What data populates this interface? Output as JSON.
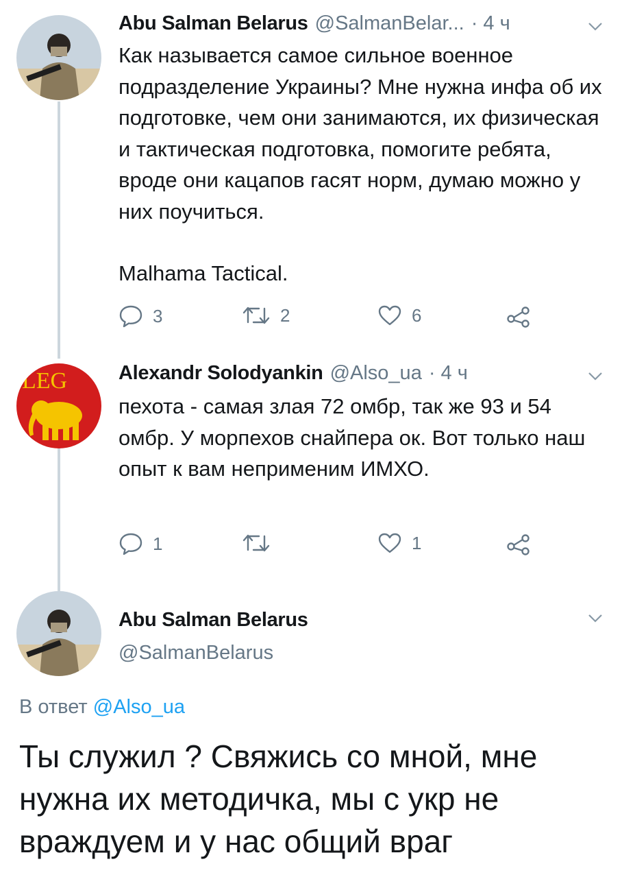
{
  "tweets": [
    {
      "name": "Abu Salman Belarus",
      "handle": "@SalmanBelar...",
      "time": "· 4 ч",
      "text": "Как называется самое сильное военное подразделение Украины? Мне нужна инфа об их подготовке, чем они занимаются, их физическая и тактическая подготовка, помогите ребята, вроде они кацапов гасят норм, думаю можно у них поучиться.",
      "text2": "Malhama Tactical.",
      "reply_count": "3",
      "retweet_count": "2",
      "like_count": "6"
    },
    {
      "name": "Alexandr Solodyankin",
      "handle": "@Also_ua",
      "time": "· 4 ч",
      "avatar_text": "LEG",
      "text": "пехота - самая злая 72 омбр, так же 93 и 54 омбр. У морпехов снайпера ок. Вот только наш опыт к вам неприменим ИМХО.",
      "reply_count": "1",
      "retweet_count": "",
      "like_count": "1"
    }
  ],
  "main_tweet": {
    "name": "Abu Salman Belarus",
    "handle": "@SalmanBelarus",
    "reply_prefix": "В ответ",
    "reply_mention": "@Also_ua",
    "text": "Ты служил ? Свяжись со мной, мне нужна их методичка, мы с укр не враждуем и у нас общий враг"
  },
  "colors": {
    "text": "#14171a",
    "secondary": "#657786",
    "link": "#1da1f2",
    "thread_line": "#ccd6dd",
    "legion_red": "#d21d1d",
    "legion_yellow": "#f5c400"
  },
  "icons": [
    "reply-icon",
    "retweet-icon",
    "like-icon",
    "share-icon",
    "chevron-down-icon"
  ]
}
